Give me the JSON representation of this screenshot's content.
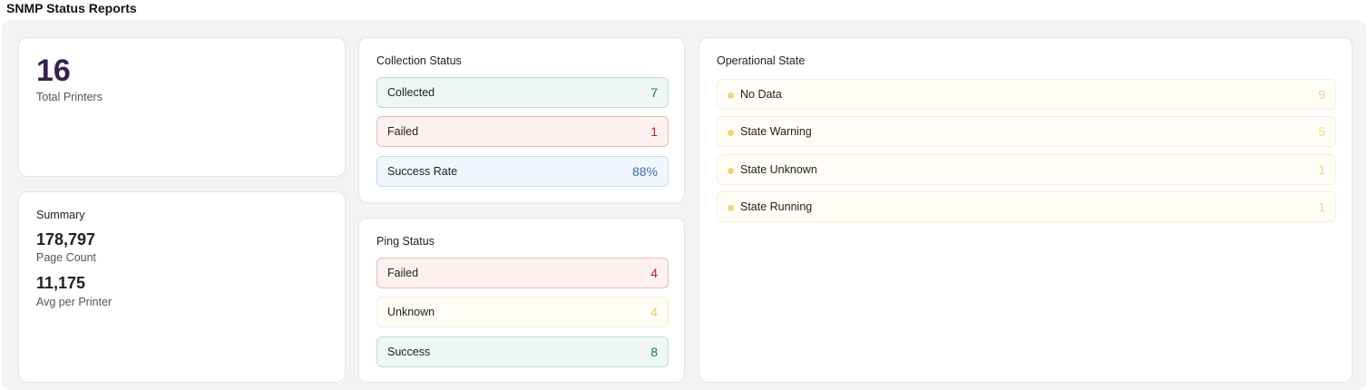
{
  "page_title": "SNMP Status Reports",
  "total": {
    "value": "16",
    "label": "Total Printers"
  },
  "summary": {
    "title": "Summary",
    "page_count": {
      "value": "178,797",
      "label": "Page Count"
    },
    "avg_per_printer": {
      "value": "11,175",
      "label": "Avg per Printer"
    }
  },
  "collection_status": {
    "title": "Collection Status",
    "rows": [
      {
        "label": "Collected",
        "value": "7",
        "status": "success",
        "color": "#1a7a4c"
      },
      {
        "label": "Failed",
        "value": "1",
        "status": "error",
        "color": "#b42424"
      },
      {
        "label": "Success Rate",
        "value": "88%",
        "status": "info",
        "color": "#3e6db5"
      }
    ]
  },
  "ping_status": {
    "title": "Ping Status",
    "rows": [
      {
        "label": "Failed",
        "value": "4",
        "status": "error",
        "color": "#b42424"
      },
      {
        "label": "Unknown",
        "value": "4",
        "status": "warning",
        "color": "#f1c76a"
      },
      {
        "label": "Success",
        "value": "8",
        "status": "success",
        "color": "#1a7a4c"
      }
    ]
  },
  "operational_state": {
    "title": "Operational State",
    "rows": [
      {
        "label": "No Data",
        "value": "9",
        "icon": "dot-icon",
        "color": "#f5d27e"
      },
      {
        "label": "State Warning",
        "value": "5",
        "icon": "dot-icon",
        "color": "#f5d27e"
      },
      {
        "label": "State Unknown",
        "value": "1",
        "icon": "dot-icon",
        "color": "#f5d27e"
      },
      {
        "label": "State Running",
        "value": "1",
        "icon": "dot-icon",
        "color": "#f5d27e"
      }
    ]
  }
}
